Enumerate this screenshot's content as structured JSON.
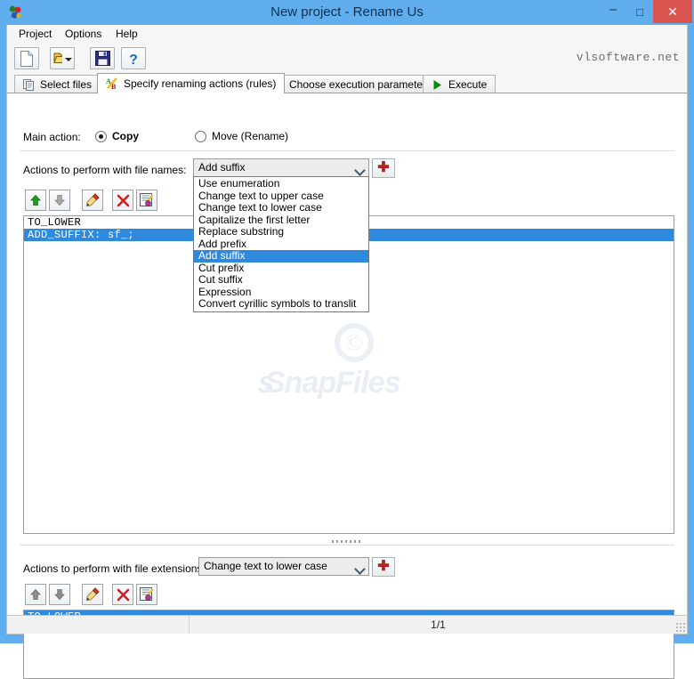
{
  "window": {
    "title": "New project - Rename Us",
    "app_icon": "app-icon",
    "minimize_label": "–",
    "maximize_label": "□",
    "close_label": "✕",
    "close_color": "#d9534f",
    "titlebar_color": "#61aeef"
  },
  "menubar": {
    "items": [
      {
        "label": "Project"
      },
      {
        "label": "Options"
      },
      {
        "label": "Help"
      }
    ]
  },
  "toolbar": {
    "buttons": [
      {
        "icon": "new-document-icon",
        "label": "New"
      },
      {
        "icon": "open-folder-icon",
        "label": "Open"
      },
      {
        "icon": "save-disk-icon",
        "label": "Save"
      },
      {
        "icon": "help-question-icon",
        "label": "Help"
      }
    ],
    "open_dropdown_icon": "chevron-down-icon",
    "brand": "vlsoftware.net"
  },
  "tabs": [
    {
      "label": "Select files",
      "icon": "files-icon",
      "active": false
    },
    {
      "label": "Specify renaming actions (rules)",
      "icon": "ab-letters-icon",
      "active": true
    },
    {
      "label": "Choose execution parameters",
      "icon": "parameters-icon",
      "active": false
    },
    {
      "label": "Execute",
      "icon": "play-triangle-icon",
      "active": false
    }
  ],
  "main_action": {
    "label": "Main action:",
    "options": [
      {
        "label": "Copy",
        "checked": true
      },
      {
        "label": "Move (Rename)",
        "checked": false
      }
    ]
  },
  "names_section": {
    "label": "Actions to perform with file names:",
    "combo_value": "Add suffix",
    "add_button_label": "✚",
    "tool_buttons": [
      {
        "icon": "move-up-icon",
        "label": "Move up"
      },
      {
        "icon": "move-down-icon",
        "label": "Move down"
      },
      {
        "icon": "edit-pen-icon",
        "label": "Edit"
      },
      {
        "icon": "delete-x-icon",
        "label": "Delete"
      },
      {
        "icon": "clear-list-icon",
        "label": "Clear"
      }
    ],
    "rules": [
      {
        "text": "TO_LOWER",
        "selected": false
      },
      {
        "text": "ADD_SUFFIX: sf_;",
        "selected": true
      }
    ]
  },
  "dropdown": {
    "open": true,
    "highlight_color": "#2f8ade",
    "items": [
      {
        "label": "Use enumeration",
        "selected": false
      },
      {
        "label": "Change text to upper case",
        "selected": false
      },
      {
        "label": "Change text to lower case",
        "selected": false
      },
      {
        "label": "Capitalize the first letter",
        "selected": false
      },
      {
        "label": "Replace substring",
        "selected": false
      },
      {
        "label": "Add prefix",
        "selected": false
      },
      {
        "label": "Add suffix",
        "selected": true
      },
      {
        "label": "Cut prefix",
        "selected": false
      },
      {
        "label": "Cut suffix",
        "selected": false
      },
      {
        "label": "Expression",
        "selected": false
      },
      {
        "label": "Convert cyrillic symbols to translit",
        "selected": false
      }
    ]
  },
  "extensions_section": {
    "label": "Actions to perform with file extensions:",
    "combo_value": "Change text to lower case",
    "add_button_label": "✚",
    "tool_buttons": [
      {
        "icon": "move-up-icon",
        "label": "Move up"
      },
      {
        "icon": "move-down-icon",
        "label": "Move down"
      },
      {
        "icon": "edit-pen-icon",
        "label": "Edit"
      },
      {
        "icon": "delete-x-icon",
        "label": "Delete"
      },
      {
        "icon": "clear-list-icon",
        "label": "Clear"
      }
    ],
    "rules": [
      {
        "text": "TO_LOWER",
        "selected": true
      }
    ]
  },
  "watermark": {
    "copyright": "©",
    "text": "SnapFiles",
    "badge": "S"
  },
  "statusbar": {
    "left_text": "",
    "center_text": "1/1"
  }
}
